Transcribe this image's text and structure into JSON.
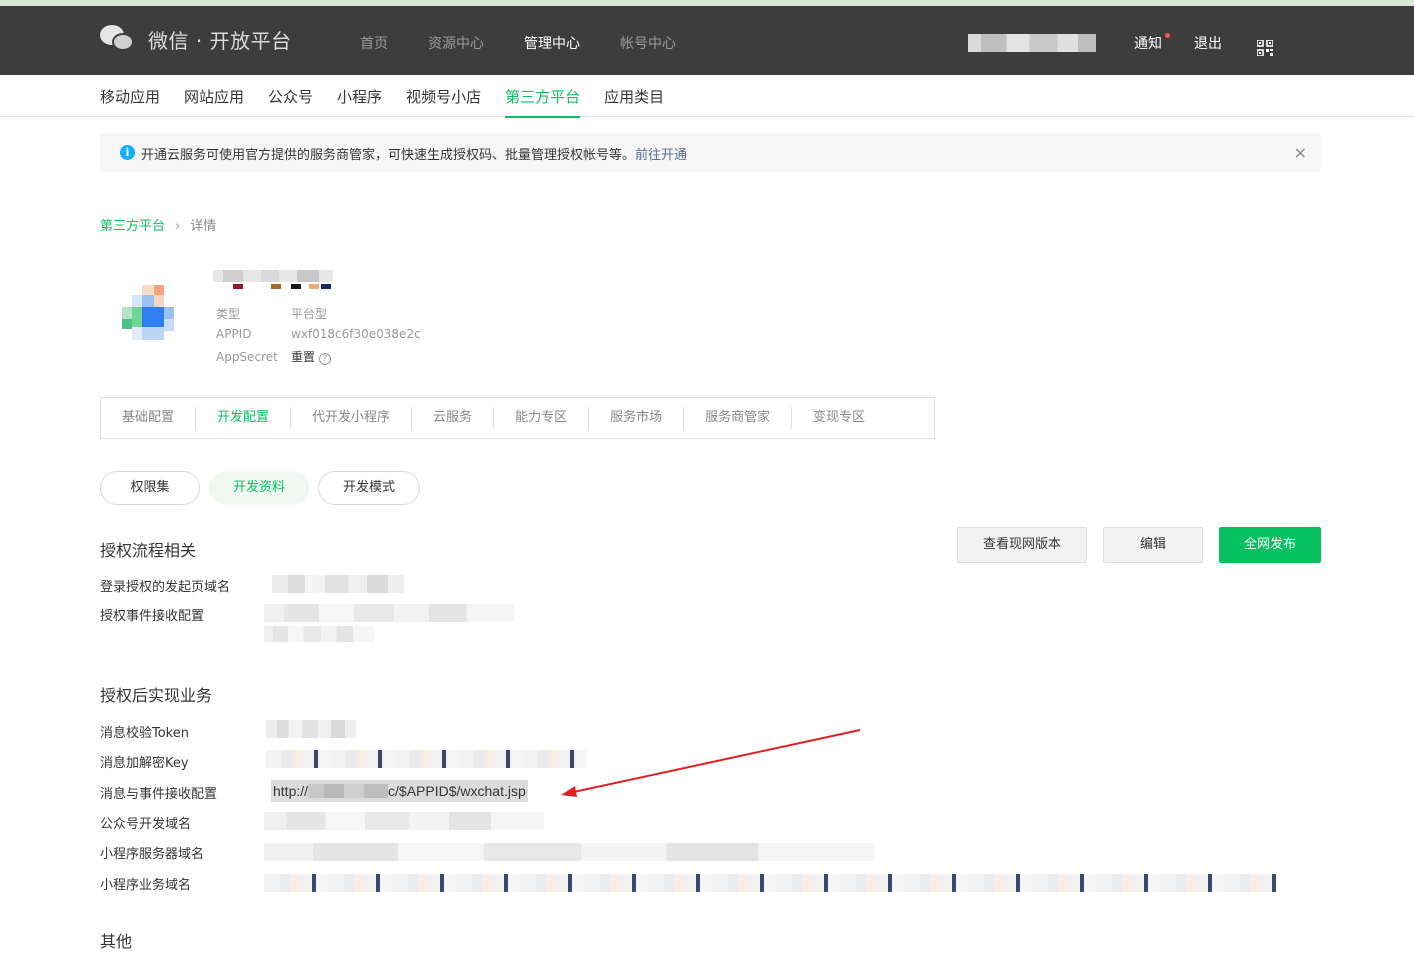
{
  "header": {
    "logo_text": "微信 · 开放平台",
    "nav": [
      "首页",
      "资源中心",
      "管理中心",
      "帐号中心"
    ],
    "active_nav": "管理中心",
    "notice_label": "通知",
    "logout_label": "退出"
  },
  "subnav": {
    "items": [
      "移动应用",
      "网站应用",
      "公众号",
      "小程序",
      "视频号小店",
      "第三方平台",
      "应用类目"
    ],
    "active": "第三方平台"
  },
  "banner": {
    "text": "开通云服务可使用官方提供的服务商管家，可快速生成授权码、批量管理授权帐号等。",
    "link": "前往开通",
    "close": "×"
  },
  "breadcrumb": {
    "root": "第三方平台",
    "separator": "›",
    "current": "详情"
  },
  "app": {
    "type_label": "类型",
    "type_value": "平台型",
    "appid_label": "APPID",
    "appid_value": "wxf018c6f30e038e2c",
    "secret_label": "AppSecret",
    "secret_action": "重置",
    "help": "?"
  },
  "tabs": [
    "基础配置",
    "开发配置",
    "代开发小程序",
    "云服务",
    "能力专区",
    "服务市场",
    "服务商管家",
    "变现专区"
  ],
  "active_tab": "开发配置",
  "pills": [
    "权限集",
    "开发资料",
    "开发模式"
  ],
  "sections": {
    "auth_flow": {
      "title": "授权流程相关",
      "rows": [
        "登录授权的发起页域名",
        "授权事件接收配置"
      ]
    },
    "post_auth": {
      "title": "授权后实现业务",
      "rows": [
        "消息校验Token",
        "消息加解密Key",
        "消息与事件接收配置",
        "公众号开发域名",
        "小程序服务器域名",
        "小程序业务域名"
      ]
    },
    "other": {
      "title": "其他"
    }
  },
  "actions": {
    "view_version": "查看现网版本",
    "edit": "编辑",
    "publish": "全网发布"
  },
  "message_url": {
    "prefix": "http://",
    "suffix": "c/$APPID$/wxchat.jsp"
  },
  "colors": {
    "brand_green": "#07c160",
    "header_bg": "#3d3d3d",
    "arrow": "#e02020"
  }
}
